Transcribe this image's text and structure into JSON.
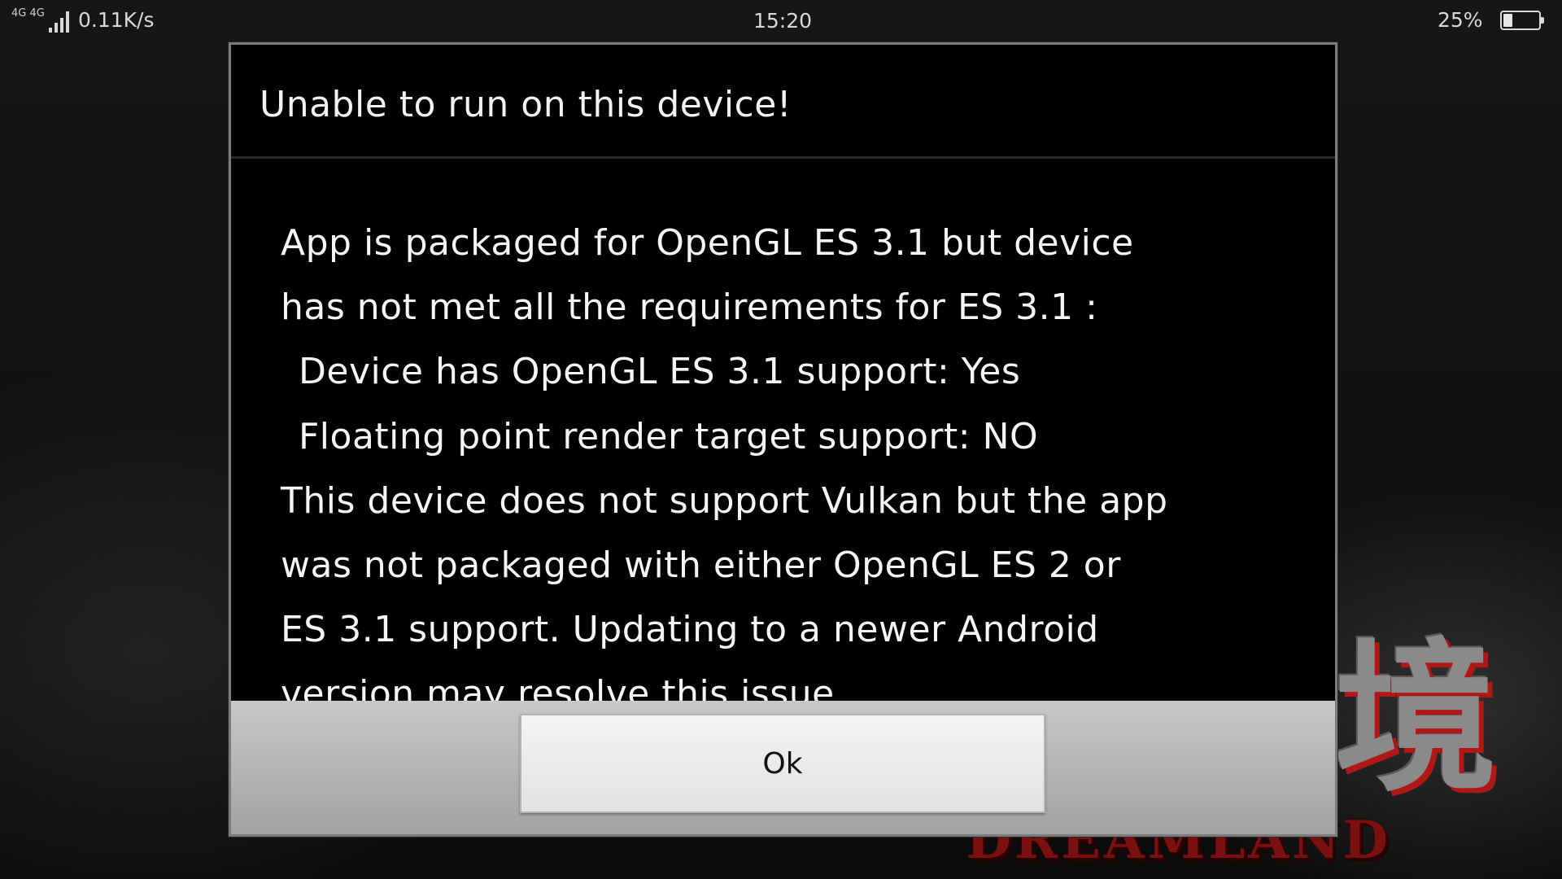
{
  "status_bar": {
    "network_label": "4G 4G",
    "speed": "0.11K/s",
    "time": "15:20",
    "battery_percent_text": "25%",
    "battery_level": 0.25,
    "icons": [
      "signal-icon",
      "battery-icon"
    ]
  },
  "dialog": {
    "title": "Unable to run on this device!",
    "message_lines": [
      "App is packaged for OpenGL ES 3.1 but device",
      "has not met all the requirements for ES 3.1 :",
      "Device has OpenGL ES 3.1 support: Yes",
      "Floating point render target support: NO",
      "This device does not support Vulkan but the app",
      "was not packaged with either OpenGL ES 2 or",
      "ES 3.1 support. Updating to a newer Android",
      "version may resolve this issue."
    ],
    "ok_label": "Ok"
  },
  "background": {
    "logo_char": "境",
    "logo_subtitle": "DREAMLAND"
  }
}
